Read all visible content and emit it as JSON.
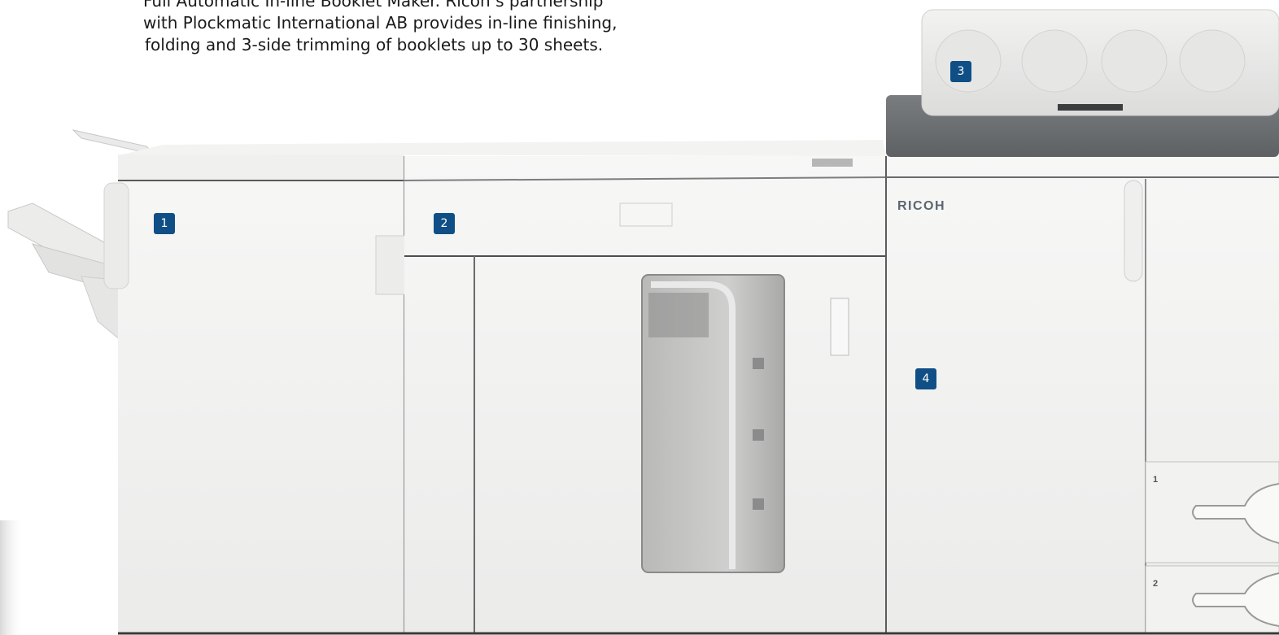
{
  "caption": {
    "line1": "Full Automatic In-line Booklet Maker. Ricoh’s partnership",
    "line2": "with Plockmatic International AB provides in-line finishing,",
    "line3": "folding and 3-side trimming of booklets up to 30 sheets."
  },
  "callouts": [
    "1",
    "2",
    "3",
    "4"
  ],
  "brand_logo_text": "RICOH",
  "trays": [
    {
      "number": "1"
    },
    {
      "number": "2"
    }
  ],
  "colors": {
    "callout_badge": "#0f4f86",
    "machine_body": "#f4f4f2",
    "scanner_base": "#6f7275"
  }
}
